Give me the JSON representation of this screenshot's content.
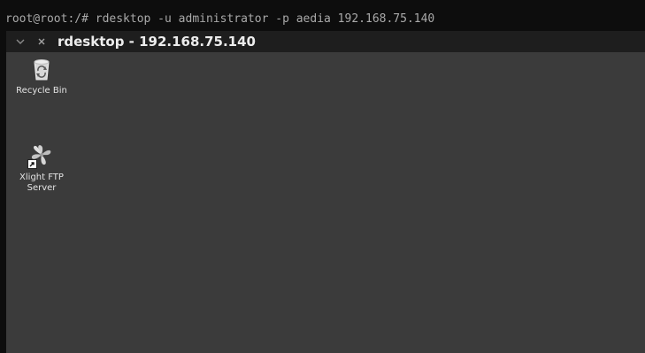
{
  "terminal": {
    "command_line": "root@root:/# rdesktop -u administrator -p aedia 192.168.75.140"
  },
  "window": {
    "title": "rdesktop - 192.168.75.140",
    "buttons": {
      "minimize_icon": "chevron-down-icon",
      "close_icon": "close-icon"
    }
  },
  "desktop": {
    "icons": [
      {
        "label": "Recycle Bin",
        "icon": "recycle-bin-icon"
      },
      {
        "label_lines": [
          "Xlight FTP",
          "Server"
        ],
        "icon": "xlight-ftp-icon",
        "shortcut": true
      }
    ]
  },
  "colors": {
    "terminal_bg": "#0d0d0d",
    "desktop_bg": "#3b3b3b",
    "titlebar_bg": "#1e1e1e"
  }
}
